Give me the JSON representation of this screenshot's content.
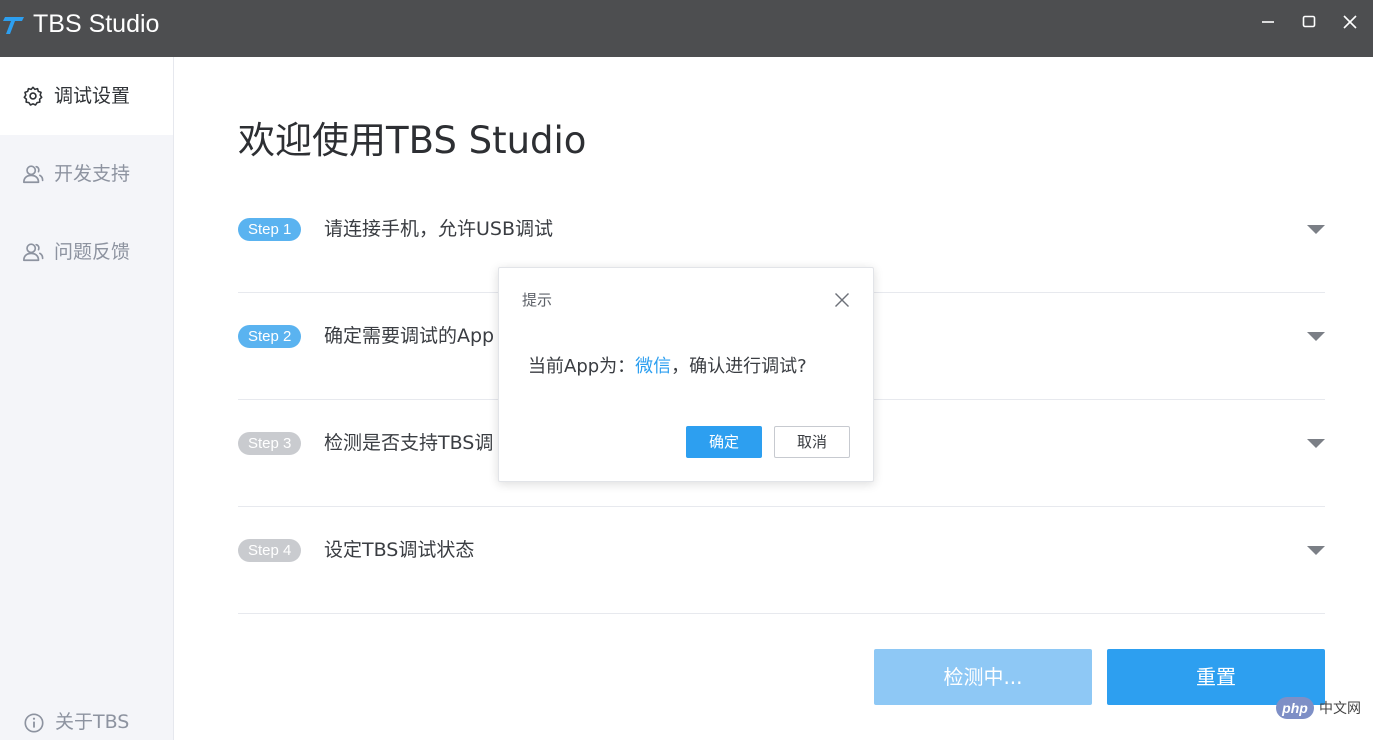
{
  "window": {
    "title": "TBS Studio",
    "minimize_icon": "minimize-icon",
    "maximize_icon": "maximize-icon",
    "close_icon": "close-icon"
  },
  "sidebar": {
    "items": [
      {
        "label": "调试设置",
        "icon": "gear-icon",
        "active": true
      },
      {
        "label": "开发支持",
        "icon": "users-icon",
        "active": false
      },
      {
        "label": "问题反馈",
        "icon": "users-icon",
        "active": false
      }
    ],
    "about": {
      "label": "关于TBS",
      "icon": "info-icon"
    }
  },
  "main": {
    "title": "欢迎使用TBS Studio",
    "steps": [
      {
        "badge": "Step 1",
        "text": "请连接手机，允许USB调试",
        "badge_color": "#5ab3f0"
      },
      {
        "badge": "Step 2",
        "text": "确定需要调试的App",
        "badge_color": "#5ab3f0"
      },
      {
        "badge": "Step 3",
        "text": "检测是否支持TBS调",
        "badge_color": "#c9cbcf"
      },
      {
        "badge": "Step 4",
        "text": "设定TBS调试状态",
        "badge_color": "#c9cbcf"
      }
    ],
    "detect_button": "检测中...",
    "reset_button": "重置"
  },
  "dialog": {
    "title": "提示",
    "message_prefix": "当前App为：",
    "message_app": "微信",
    "message_suffix": "，确认进行调试?",
    "ok_label": "确定",
    "cancel_label": "取消"
  },
  "watermark": {
    "badge": "php",
    "text": "中文网"
  },
  "colors": {
    "titlebar": "#4d4e50",
    "accent": "#2d9ff0",
    "accent_light": "#8ec8f5",
    "sidebar_bg": "#f4f5f9"
  }
}
